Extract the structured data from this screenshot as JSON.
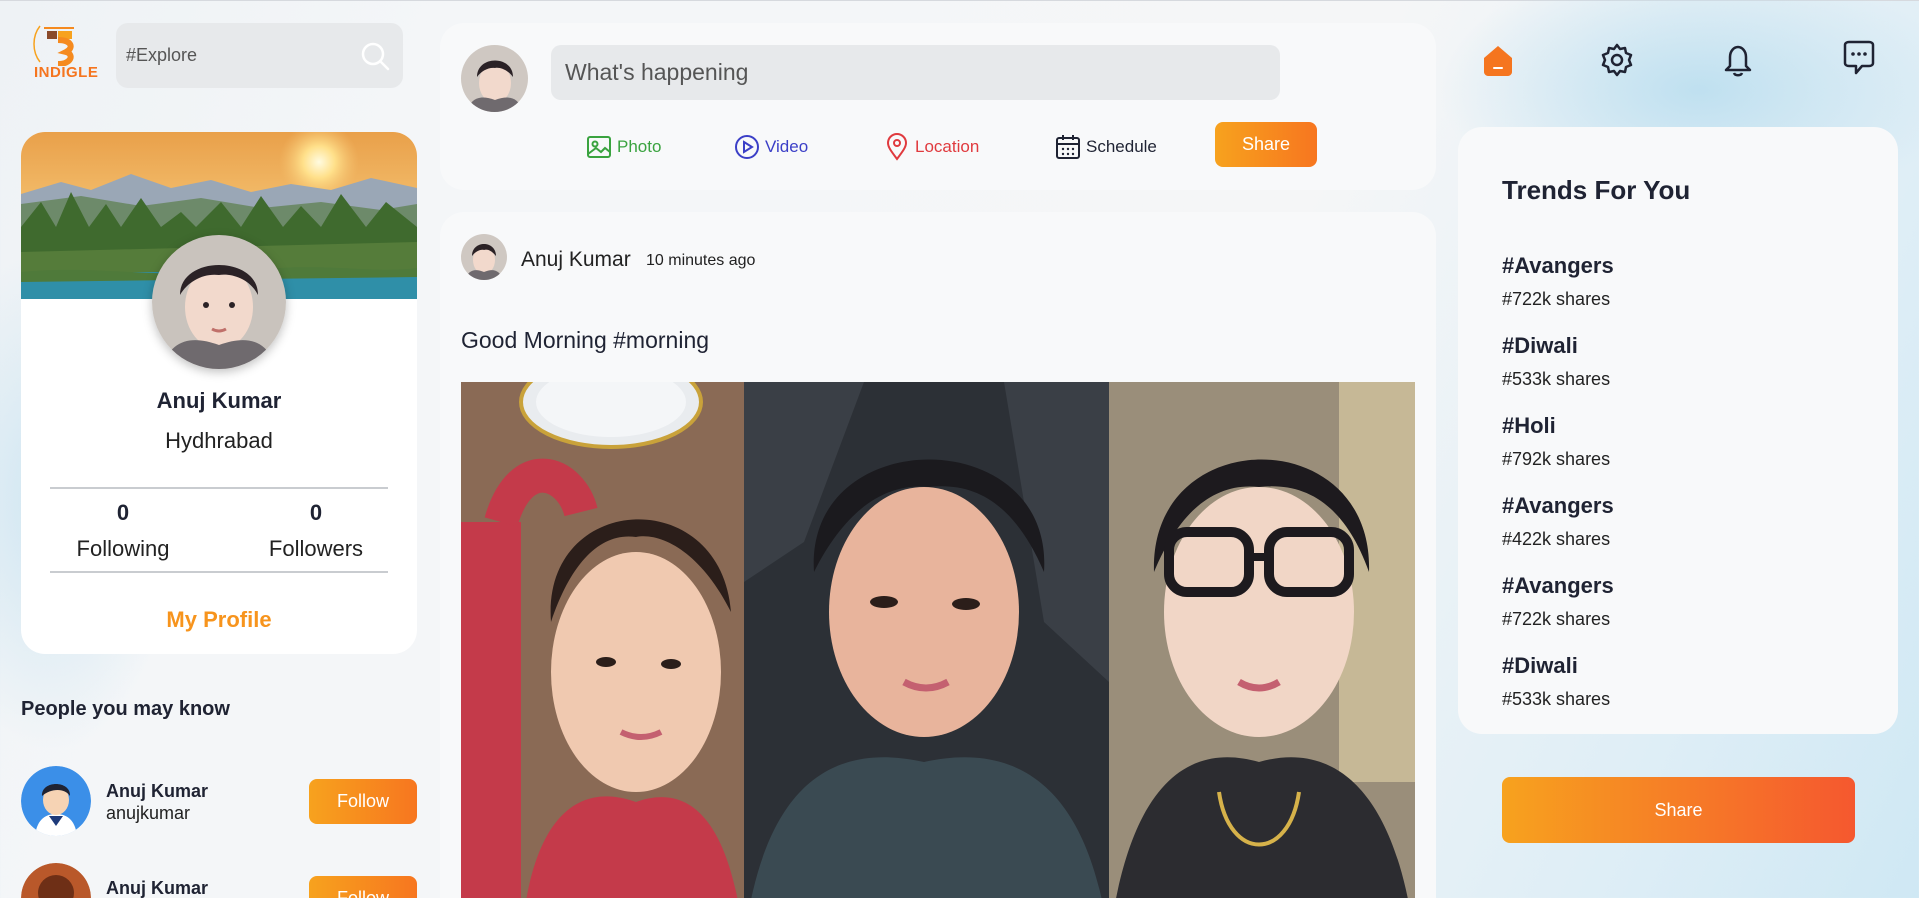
{
  "brand": {
    "logo_text": "INDIGLE"
  },
  "search": {
    "placeholder": "#Explore"
  },
  "profile": {
    "name": "Anuj Kumar",
    "location": "Hydhrabad",
    "following_count": "0",
    "following_label": "Following",
    "followers_count": "0",
    "followers_label": "Followers",
    "my_profile_link": "My Profile"
  },
  "people_you_may_know": {
    "title": "People you may know",
    "items": [
      {
        "name": "Anuj Kumar",
        "username": "anujkumar",
        "button": "Follow"
      },
      {
        "name": "Anuj Kumar",
        "username": "",
        "button": "Follow"
      }
    ]
  },
  "composer": {
    "placeholder": "What's happening",
    "options": [
      {
        "label": "Photo",
        "icon": "photo-icon",
        "color": "#3aa33f"
      },
      {
        "label": "Video",
        "icon": "video-icon",
        "color": "#3b3fc7"
      },
      {
        "label": "Location",
        "icon": "location-icon",
        "color": "#e03a3e"
      },
      {
        "label": "Schedule",
        "icon": "calendar-icon",
        "color": "#1f2333"
      }
    ],
    "share_button": "Share"
  },
  "post": {
    "author": "Anuj Kumar",
    "time": "10 minutes ago",
    "caption": "Good Morning #morning"
  },
  "top_nav": {
    "icons": [
      "home-icon",
      "settings-icon",
      "notification-icon",
      "messages-icon"
    ]
  },
  "trends": {
    "title": "Trends For You",
    "items": [
      {
        "tag": "#Avangers",
        "shares": "#722k shares"
      },
      {
        "tag": "#Diwali",
        "shares": "#533k shares"
      },
      {
        "tag": "#Holi",
        "shares": "#792k shares"
      },
      {
        "tag": "#Avangers",
        "shares": "#422k shares"
      },
      {
        "tag": "#Avangers",
        "shares": "#722k shares"
      },
      {
        "tag": "#Diwali",
        "shares": "#533k shares"
      }
    ]
  },
  "share_button": "Share",
  "colors": {
    "accent": "#f7941d",
    "accent_dark": "#f5582f",
    "text": "#1f2333"
  }
}
